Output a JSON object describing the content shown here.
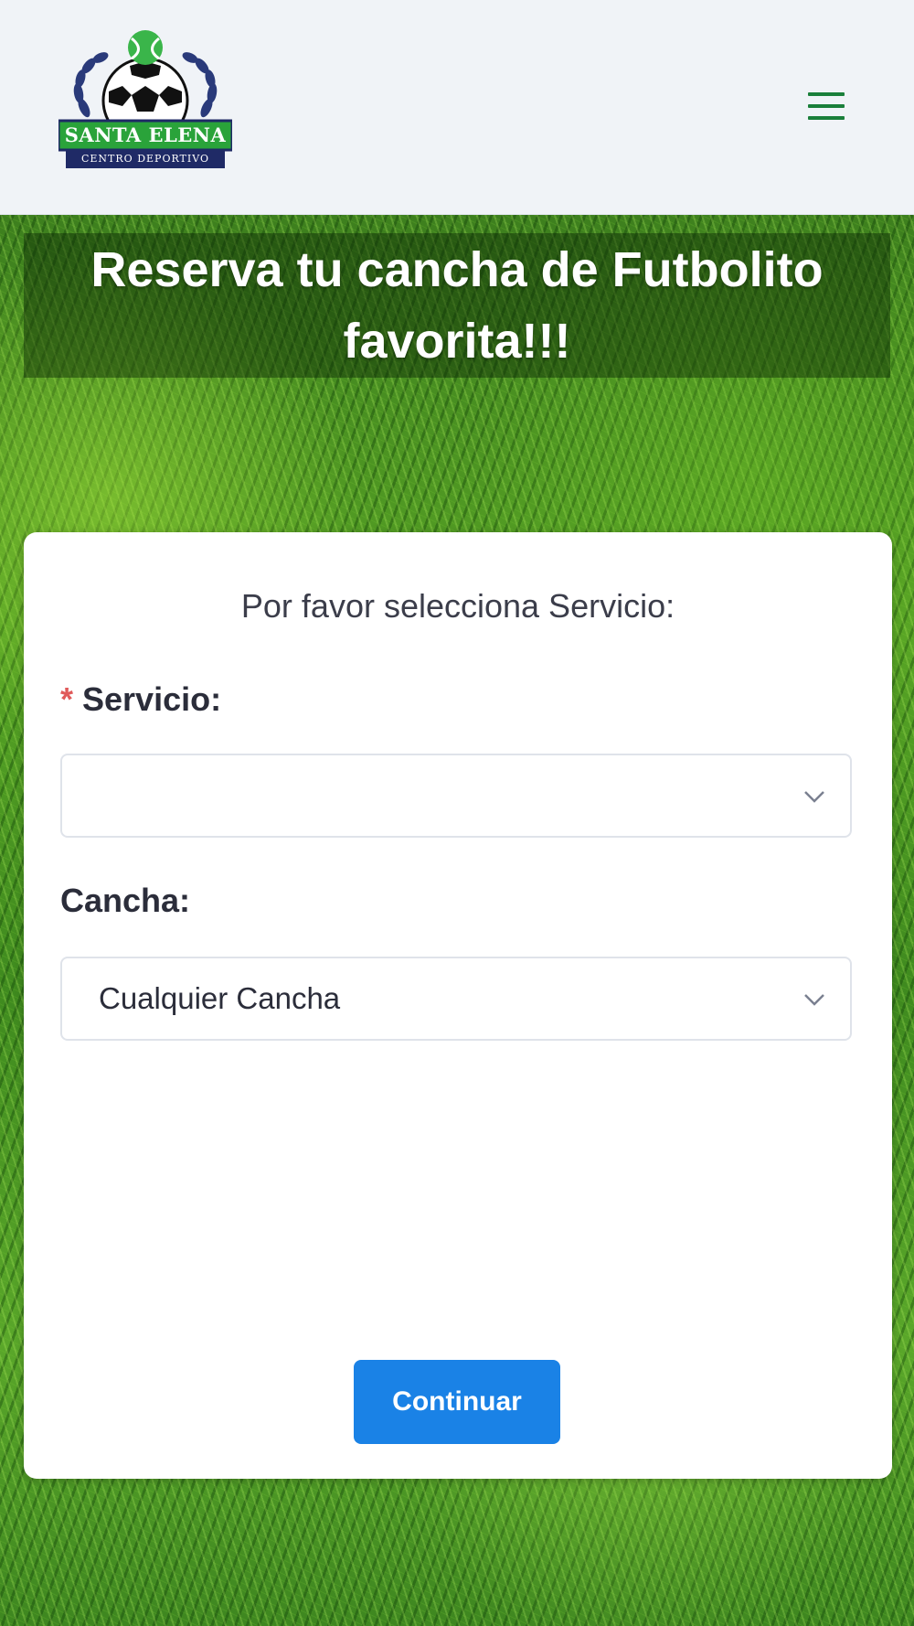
{
  "header": {
    "logo": {
      "name": "SANTA ELENA",
      "subtitle": "CENTRO DEPORTIVO"
    },
    "menu_icon": "hamburger-menu-icon",
    "menu_color": "#1a7f3a"
  },
  "hero": {
    "title": "Reserva tu cancha de Futbolito favorita!!!"
  },
  "form": {
    "heading": "Por favor selecciona Servicio:",
    "service": {
      "required_mark": "*",
      "label": "Servicio:",
      "value": ""
    },
    "court": {
      "label": "Cancha:",
      "value": "Cualquier Cancha"
    },
    "continue_label": "Continuar"
  },
  "colors": {
    "primary_button": "#1a82e6",
    "required": "#e05a5a",
    "brand_green": "#2aa33a",
    "brand_navy": "#1f2a66"
  }
}
